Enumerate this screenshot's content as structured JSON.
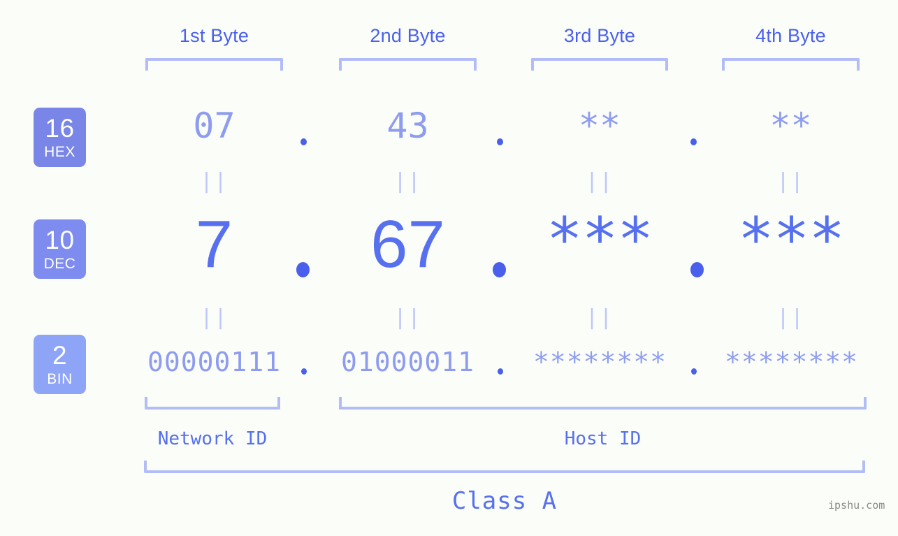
{
  "theme": {
    "background": "#fbfdf8",
    "accent_strong": "#4a60ec",
    "accent_mid": "#5670ef",
    "accent_light": "#8e9cf0",
    "bracket": "#b2bcf7",
    "equals": "#bfc8f8",
    "badge_hex_bg": "#7986e8",
    "badge_dec_bg": "#7e8cef",
    "badge_bin_bg": "#8ea4f6",
    "watermark": "#8a8a8a"
  },
  "byte_headers": [
    {
      "label": "1st Byte"
    },
    {
      "label": "2nd Byte"
    },
    {
      "label": "3rd Byte"
    },
    {
      "label": "4th Byte"
    }
  ],
  "bases": [
    {
      "number": "16",
      "name": "HEX"
    },
    {
      "number": "10",
      "name": "DEC"
    },
    {
      "number": "2",
      "name": "BIN"
    }
  ],
  "rows": {
    "hex": {
      "values": [
        "07",
        "43",
        "**",
        "**"
      ]
    },
    "dec": {
      "values": [
        "7",
        "67",
        "***",
        "***"
      ]
    },
    "bin": {
      "values": [
        "00000111",
        "01000011",
        "********",
        "********"
      ]
    }
  },
  "separators": {
    "dot": "."
  },
  "equals_marks": {
    "glyph": "||",
    "count_per_row": 4
  },
  "id_sections": [
    {
      "label": "Network ID"
    },
    {
      "label": "Host ID"
    }
  ],
  "class": {
    "label": "Class A"
  },
  "watermark": {
    "text": "ipshu.com"
  }
}
